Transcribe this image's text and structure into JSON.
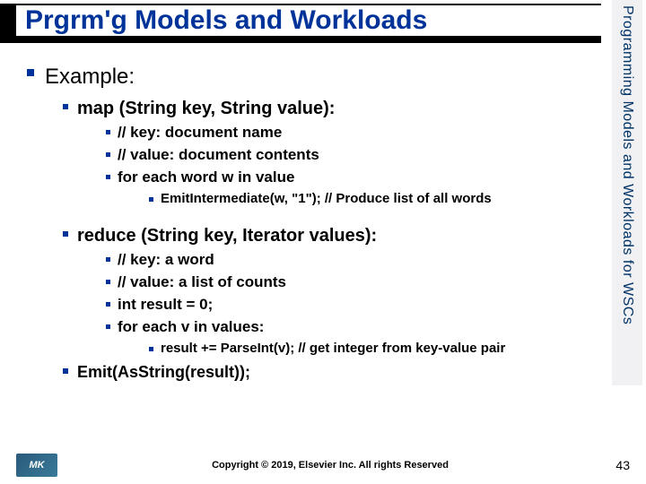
{
  "title": "Prgrm'g Models and Workloads",
  "side_label": "Programming Models and Workloads for WSCs",
  "content": {
    "example_label": "Example:",
    "map_sig": "map (String key, String value):",
    "map_l1": "// key:  document name",
    "map_l2": "// value:  document contents",
    "map_l3": "for each word w in value",
    "map_l3_a": "EmitIntermediate(w, \"1\");  // Produce list of all words",
    "reduce_sig": "reduce (String key, Iterator values):",
    "red_l1": "// key:  a word",
    "red_l2": "// value:  a list of counts",
    "red_l3": "int result = 0;",
    "red_l4": "for each v in values:",
    "red_l4_a": "result += ParseInt(v);  // get integer from key-value pair",
    "red_l5": "Emit(AsString(result));"
  },
  "footer": {
    "logo_text": "MK",
    "copyright": "Copyright © 2019, Elsevier Inc. All rights Reserved",
    "page": "43"
  }
}
